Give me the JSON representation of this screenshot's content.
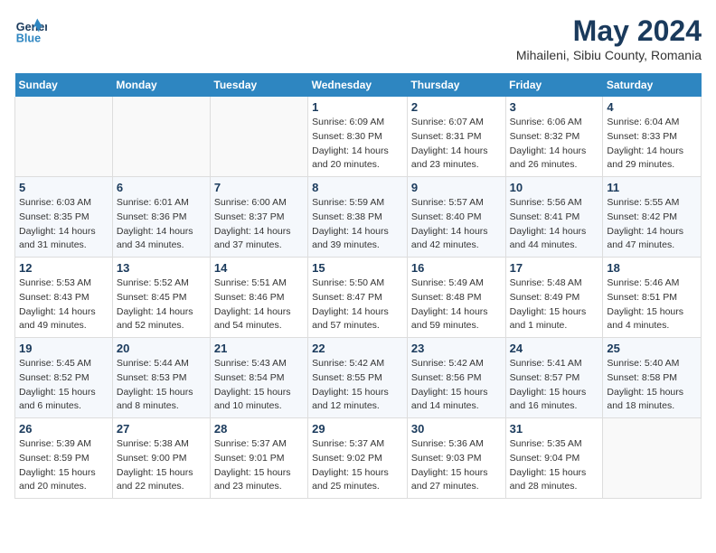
{
  "header": {
    "logo_line1": "General",
    "logo_line2": "Blue",
    "month_year": "May 2024",
    "location": "Mihaileni, Sibiu County, Romania"
  },
  "days_of_week": [
    "Sunday",
    "Monday",
    "Tuesday",
    "Wednesday",
    "Thursday",
    "Friday",
    "Saturday"
  ],
  "weeks": [
    [
      {
        "day": "",
        "sunrise": "",
        "sunset": "",
        "daylight": ""
      },
      {
        "day": "",
        "sunrise": "",
        "sunset": "",
        "daylight": ""
      },
      {
        "day": "",
        "sunrise": "",
        "sunset": "",
        "daylight": ""
      },
      {
        "day": "1",
        "sunrise": "Sunrise: 6:09 AM",
        "sunset": "Sunset: 8:30 PM",
        "daylight": "Daylight: 14 hours and 20 minutes."
      },
      {
        "day": "2",
        "sunrise": "Sunrise: 6:07 AM",
        "sunset": "Sunset: 8:31 PM",
        "daylight": "Daylight: 14 hours and 23 minutes."
      },
      {
        "day": "3",
        "sunrise": "Sunrise: 6:06 AM",
        "sunset": "Sunset: 8:32 PM",
        "daylight": "Daylight: 14 hours and 26 minutes."
      },
      {
        "day": "4",
        "sunrise": "Sunrise: 6:04 AM",
        "sunset": "Sunset: 8:33 PM",
        "daylight": "Daylight: 14 hours and 29 minutes."
      }
    ],
    [
      {
        "day": "5",
        "sunrise": "Sunrise: 6:03 AM",
        "sunset": "Sunset: 8:35 PM",
        "daylight": "Daylight: 14 hours and 31 minutes."
      },
      {
        "day": "6",
        "sunrise": "Sunrise: 6:01 AM",
        "sunset": "Sunset: 8:36 PM",
        "daylight": "Daylight: 14 hours and 34 minutes."
      },
      {
        "day": "7",
        "sunrise": "Sunrise: 6:00 AM",
        "sunset": "Sunset: 8:37 PM",
        "daylight": "Daylight: 14 hours and 37 minutes."
      },
      {
        "day": "8",
        "sunrise": "Sunrise: 5:59 AM",
        "sunset": "Sunset: 8:38 PM",
        "daylight": "Daylight: 14 hours and 39 minutes."
      },
      {
        "day": "9",
        "sunrise": "Sunrise: 5:57 AM",
        "sunset": "Sunset: 8:40 PM",
        "daylight": "Daylight: 14 hours and 42 minutes."
      },
      {
        "day": "10",
        "sunrise": "Sunrise: 5:56 AM",
        "sunset": "Sunset: 8:41 PM",
        "daylight": "Daylight: 14 hours and 44 minutes."
      },
      {
        "day": "11",
        "sunrise": "Sunrise: 5:55 AM",
        "sunset": "Sunset: 8:42 PM",
        "daylight": "Daylight: 14 hours and 47 minutes."
      }
    ],
    [
      {
        "day": "12",
        "sunrise": "Sunrise: 5:53 AM",
        "sunset": "Sunset: 8:43 PM",
        "daylight": "Daylight: 14 hours and 49 minutes."
      },
      {
        "day": "13",
        "sunrise": "Sunrise: 5:52 AM",
        "sunset": "Sunset: 8:45 PM",
        "daylight": "Daylight: 14 hours and 52 minutes."
      },
      {
        "day": "14",
        "sunrise": "Sunrise: 5:51 AM",
        "sunset": "Sunset: 8:46 PM",
        "daylight": "Daylight: 14 hours and 54 minutes."
      },
      {
        "day": "15",
        "sunrise": "Sunrise: 5:50 AM",
        "sunset": "Sunset: 8:47 PM",
        "daylight": "Daylight: 14 hours and 57 minutes."
      },
      {
        "day": "16",
        "sunrise": "Sunrise: 5:49 AM",
        "sunset": "Sunset: 8:48 PM",
        "daylight": "Daylight: 14 hours and 59 minutes."
      },
      {
        "day": "17",
        "sunrise": "Sunrise: 5:48 AM",
        "sunset": "Sunset: 8:49 PM",
        "daylight": "Daylight: 15 hours and 1 minute."
      },
      {
        "day": "18",
        "sunrise": "Sunrise: 5:46 AM",
        "sunset": "Sunset: 8:51 PM",
        "daylight": "Daylight: 15 hours and 4 minutes."
      }
    ],
    [
      {
        "day": "19",
        "sunrise": "Sunrise: 5:45 AM",
        "sunset": "Sunset: 8:52 PM",
        "daylight": "Daylight: 15 hours and 6 minutes."
      },
      {
        "day": "20",
        "sunrise": "Sunrise: 5:44 AM",
        "sunset": "Sunset: 8:53 PM",
        "daylight": "Daylight: 15 hours and 8 minutes."
      },
      {
        "day": "21",
        "sunrise": "Sunrise: 5:43 AM",
        "sunset": "Sunset: 8:54 PM",
        "daylight": "Daylight: 15 hours and 10 minutes."
      },
      {
        "day": "22",
        "sunrise": "Sunrise: 5:42 AM",
        "sunset": "Sunset: 8:55 PM",
        "daylight": "Daylight: 15 hours and 12 minutes."
      },
      {
        "day": "23",
        "sunrise": "Sunrise: 5:42 AM",
        "sunset": "Sunset: 8:56 PM",
        "daylight": "Daylight: 15 hours and 14 minutes."
      },
      {
        "day": "24",
        "sunrise": "Sunrise: 5:41 AM",
        "sunset": "Sunset: 8:57 PM",
        "daylight": "Daylight: 15 hours and 16 minutes."
      },
      {
        "day": "25",
        "sunrise": "Sunrise: 5:40 AM",
        "sunset": "Sunset: 8:58 PM",
        "daylight": "Daylight: 15 hours and 18 minutes."
      }
    ],
    [
      {
        "day": "26",
        "sunrise": "Sunrise: 5:39 AM",
        "sunset": "Sunset: 8:59 PM",
        "daylight": "Daylight: 15 hours and 20 minutes."
      },
      {
        "day": "27",
        "sunrise": "Sunrise: 5:38 AM",
        "sunset": "Sunset: 9:00 PM",
        "daylight": "Daylight: 15 hours and 22 minutes."
      },
      {
        "day": "28",
        "sunrise": "Sunrise: 5:37 AM",
        "sunset": "Sunset: 9:01 PM",
        "daylight": "Daylight: 15 hours and 23 minutes."
      },
      {
        "day": "29",
        "sunrise": "Sunrise: 5:37 AM",
        "sunset": "Sunset: 9:02 PM",
        "daylight": "Daylight: 15 hours and 25 minutes."
      },
      {
        "day": "30",
        "sunrise": "Sunrise: 5:36 AM",
        "sunset": "Sunset: 9:03 PM",
        "daylight": "Daylight: 15 hours and 27 minutes."
      },
      {
        "day": "31",
        "sunrise": "Sunrise: 5:35 AM",
        "sunset": "Sunset: 9:04 PM",
        "daylight": "Daylight: 15 hours and 28 minutes."
      },
      {
        "day": "",
        "sunrise": "",
        "sunset": "",
        "daylight": ""
      }
    ]
  ]
}
